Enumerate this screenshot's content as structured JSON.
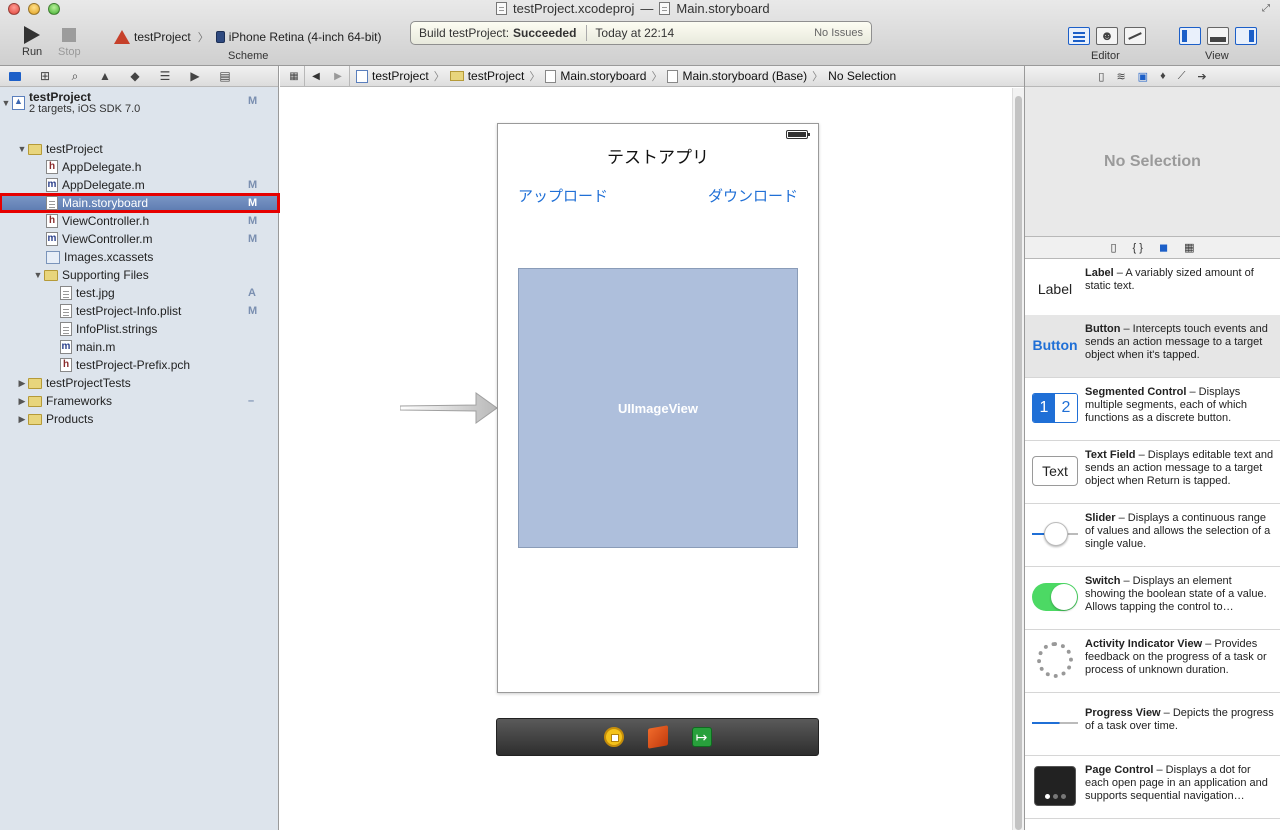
{
  "window": {
    "title_project": "testProject.xcodeproj",
    "title_dash": "—",
    "title_file": "Main.storyboard"
  },
  "toolbar": {
    "run_label": "Run",
    "stop_label": "Stop",
    "scheme_target": "testProject",
    "scheme_device": "iPhone Retina (4-inch 64-bit)",
    "scheme_label": "Scheme",
    "editor_label": "Editor",
    "view_label": "View"
  },
  "activity": {
    "prefix": "Build testProject:",
    "status": "Succeeded",
    "time": "Today at 22:14",
    "issues": "No Issues"
  },
  "navigator": {
    "project_name": "testProject",
    "project_sub": "2 targets, iOS SDK 7.0",
    "project_badge": "M",
    "items": [
      {
        "label": "testProject",
        "badge": ""
      },
      {
        "label": "AppDelegate.h",
        "badge": ""
      },
      {
        "label": "AppDelegate.m",
        "badge": "M"
      },
      {
        "label": "Main.storyboard",
        "badge": "M"
      },
      {
        "label": "ViewController.h",
        "badge": "M"
      },
      {
        "label": "ViewController.m",
        "badge": "M"
      },
      {
        "label": "Images.xcassets",
        "badge": ""
      },
      {
        "label": "Supporting Files",
        "badge": ""
      },
      {
        "label": "test.jpg",
        "badge": "A"
      },
      {
        "label": "testProject-Info.plist",
        "badge": "M"
      },
      {
        "label": "InfoPlist.strings",
        "badge": ""
      },
      {
        "label": "main.m",
        "badge": ""
      },
      {
        "label": "testProject-Prefix.pch",
        "badge": ""
      },
      {
        "label": "testProjectTests",
        "badge": ""
      },
      {
        "label": "Frameworks",
        "badge": "–"
      },
      {
        "label": "Products",
        "badge": ""
      }
    ]
  },
  "jumpbar": {
    "crumbs": [
      "testProject",
      "testProject",
      "Main.storyboard",
      "Main.storyboard (Base)",
      "No Selection"
    ]
  },
  "canvas": {
    "scene_title": "テストアプリ",
    "upload_button": "アップロード",
    "download_button": "ダウンロード",
    "imageview_label": "UIImageView"
  },
  "inspector": {
    "no_selection": "No Selection"
  },
  "library": {
    "items": [
      {
        "thumb": "Label",
        "title": "Label",
        "desc": " – A variably sized amount of static text."
      },
      {
        "thumb": "Button",
        "title": "Button",
        "desc": " – Intercepts touch events and sends an action message to a target object when it's tapped."
      },
      {
        "thumb_a": "1",
        "thumb_b": "2",
        "title": "Segmented Control",
        "desc": " – Displays multiple segments, each of which functions as a discrete button."
      },
      {
        "thumb": "Text",
        "title": "Text Field",
        "desc": " – Displays editable text and sends an action message to a target object when Return is tapped."
      },
      {
        "title": "Slider",
        "desc": " – Displays a continuous range of values and allows the selection of a single value."
      },
      {
        "title": "Switch",
        "desc": " – Displays an element showing the boolean state of a value. Allows tapping the control to…"
      },
      {
        "title": "Activity Indicator View",
        "desc": " – Provides feedback on the progress of a task or process of unknown duration."
      },
      {
        "title": "Progress View",
        "desc": " – Depicts the progress of a task over time."
      },
      {
        "title": "Page Control",
        "desc": " – Displays a dot for each open page in an application and supports sequential navigation…"
      }
    ]
  },
  "colors": {
    "accent": "#1c5fc8",
    "ios_link": "#1f6fd6",
    "selection_outline": "#e60000",
    "imageview_fill": "#aebfdc"
  }
}
